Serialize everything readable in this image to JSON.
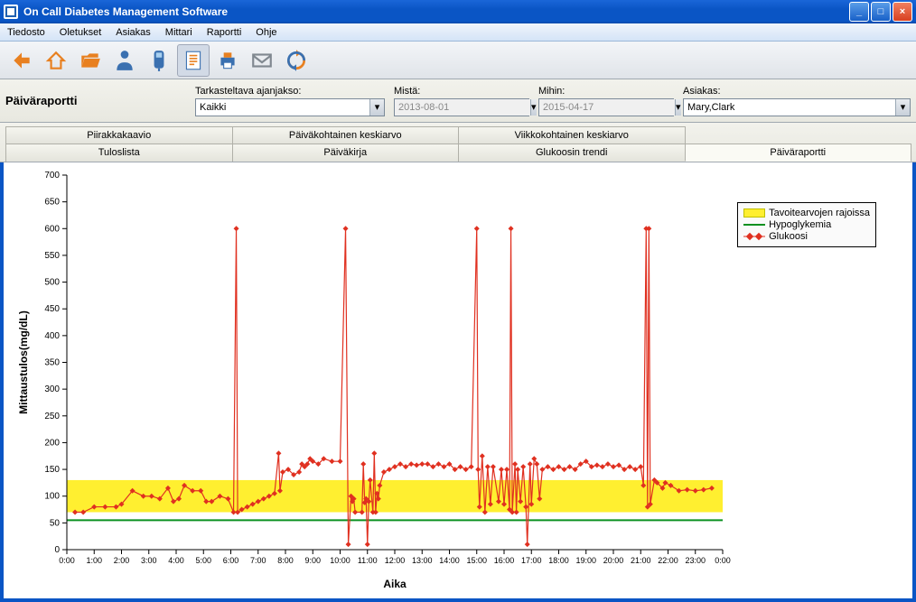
{
  "window": {
    "title": "On Call Diabetes Management Software"
  },
  "menu": {
    "items": [
      "Tiedosto",
      "Oletukset",
      "Asiakas",
      "Mittari",
      "Raportti",
      "Ohje"
    ]
  },
  "toolbar": {
    "icons": [
      "back-icon",
      "home-icon",
      "open-icon",
      "user-icon",
      "meter-icon",
      "report-icon",
      "print-icon",
      "mail-icon",
      "sync-icon"
    ]
  },
  "filters": {
    "title": "Päiväraportti",
    "range_label": "Tarkasteltava ajanjakso:",
    "range_value": "Kaikki",
    "from_label": "Mistä:",
    "from_value": "2013-08-01",
    "to_label": "Mihin:",
    "to_value": "2015-04-17",
    "client_label": "Asiakas:",
    "client_value": "Mary,Clark"
  },
  "tabs": {
    "row1": [
      "Piirakkakaavio",
      "Päiväkohtainen keskiarvo",
      "Viikkokohtainen keskiarvo",
      ""
    ],
    "row2": [
      "Tuloslista",
      "Päiväkirja",
      "Glukoosin trendi",
      "Päiväraportti"
    ],
    "active": "Päiväraportti"
  },
  "legend": {
    "target": "Tavoitearvojen rajoissa",
    "hypo": "Hypoglykemia",
    "glucose": "Glukoosi"
  },
  "chart_data": {
    "type": "line",
    "xlabel": "Aika",
    "ylabel": "Mittaustulos(mg/dL)",
    "ylim": [
      0,
      700
    ],
    "y_ticks": [
      0,
      50,
      100,
      150,
      200,
      250,
      300,
      350,
      400,
      450,
      500,
      550,
      600,
      650,
      700
    ],
    "x_ticks": [
      "0:00",
      "1:00",
      "2:00",
      "3:00",
      "4:00",
      "5:00",
      "6:00",
      "7:00",
      "8:00",
      "9:00",
      "10:00",
      "11:00",
      "12:00",
      "13:00",
      "14:00",
      "15:00",
      "16:00",
      "17:00",
      "18:00",
      "19:00",
      "20:00",
      "21:00",
      "22:00",
      "23:00",
      "0:00"
    ],
    "target_band": {
      "low": 70,
      "high": 130
    },
    "hypo_line": 55,
    "series": [
      {
        "name": "Glukoosi",
        "color": "#e03020",
        "points": [
          [
            0.3,
            70
          ],
          [
            0.6,
            70
          ],
          [
            1.0,
            80
          ],
          [
            1.4,
            80
          ],
          [
            1.8,
            80
          ],
          [
            2.0,
            85
          ],
          [
            2.4,
            110
          ],
          [
            2.8,
            100
          ],
          [
            3.1,
            100
          ],
          [
            3.4,
            95
          ],
          [
            3.7,
            115
          ],
          [
            3.9,
            90
          ],
          [
            4.1,
            95
          ],
          [
            4.3,
            120
          ],
          [
            4.6,
            110
          ],
          [
            4.9,
            110
          ],
          [
            5.1,
            90
          ],
          [
            5.3,
            90
          ],
          [
            5.6,
            100
          ],
          [
            5.9,
            95
          ],
          [
            6.1,
            70
          ],
          [
            6.2,
            600
          ],
          [
            6.25,
            70
          ],
          [
            6.4,
            75
          ],
          [
            6.6,
            80
          ],
          [
            6.8,
            85
          ],
          [
            7.0,
            90
          ],
          [
            7.2,
            95
          ],
          [
            7.4,
            100
          ],
          [
            7.6,
            105
          ],
          [
            7.75,
            180
          ],
          [
            7.8,
            110
          ],
          [
            7.9,
            145
          ],
          [
            8.1,
            150
          ],
          [
            8.3,
            140
          ],
          [
            8.5,
            145
          ],
          [
            8.6,
            160
          ],
          [
            8.7,
            155
          ],
          [
            8.8,
            160
          ],
          [
            8.9,
            170
          ],
          [
            9.0,
            165
          ],
          [
            9.2,
            160
          ],
          [
            9.4,
            170
          ],
          [
            9.7,
            165
          ],
          [
            10.0,
            165
          ],
          [
            10.2,
            600
          ],
          [
            10.3,
            10
          ],
          [
            10.4,
            100
          ],
          [
            10.45,
            90
          ],
          [
            10.5,
            95
          ],
          [
            10.55,
            70
          ],
          [
            10.8,
            70
          ],
          [
            10.85,
            160
          ],
          [
            10.9,
            88
          ],
          [
            10.95,
            95
          ],
          [
            11.0,
            10
          ],
          [
            11.05,
            90
          ],
          [
            11.1,
            130
          ],
          [
            11.2,
            70
          ],
          [
            11.25,
            180
          ],
          [
            11.3,
            70
          ],
          [
            11.35,
            105
          ],
          [
            11.4,
            95
          ],
          [
            11.45,
            120
          ],
          [
            11.6,
            145
          ],
          [
            11.8,
            150
          ],
          [
            12.0,
            155
          ],
          [
            12.2,
            160
          ],
          [
            12.4,
            155
          ],
          [
            12.6,
            160
          ],
          [
            12.8,
            158
          ],
          [
            13.0,
            160
          ],
          [
            13.2,
            160
          ],
          [
            13.4,
            155
          ],
          [
            13.6,
            160
          ],
          [
            13.8,
            155
          ],
          [
            14.0,
            160
          ],
          [
            14.2,
            150
          ],
          [
            14.4,
            155
          ],
          [
            14.6,
            150
          ],
          [
            14.8,
            155
          ],
          [
            15.0,
            600
          ],
          [
            15.05,
            150
          ],
          [
            15.1,
            80
          ],
          [
            15.2,
            175
          ],
          [
            15.3,
            70
          ],
          [
            15.4,
            155
          ],
          [
            15.5,
            85
          ],
          [
            15.6,
            155
          ],
          [
            15.8,
            90
          ],
          [
            15.9,
            150
          ],
          [
            16.0,
            85
          ],
          [
            16.1,
            150
          ],
          [
            16.2,
            75
          ],
          [
            16.25,
            600
          ],
          [
            16.3,
            70
          ],
          [
            16.4,
            160
          ],
          [
            16.45,
            70
          ],
          [
            16.5,
            150
          ],
          [
            16.6,
            90
          ],
          [
            16.7,
            155
          ],
          [
            16.8,
            80
          ],
          [
            16.85,
            10
          ],
          [
            16.95,
            160
          ],
          [
            17.0,
            85
          ],
          [
            17.1,
            170
          ],
          [
            17.2,
            160
          ],
          [
            17.3,
            95
          ],
          [
            17.4,
            150
          ],
          [
            17.6,
            155
          ],
          [
            17.8,
            150
          ],
          [
            18.0,
            155
          ],
          [
            18.2,
            150
          ],
          [
            18.4,
            155
          ],
          [
            18.6,
            150
          ],
          [
            18.8,
            160
          ],
          [
            19.0,
            165
          ],
          [
            19.2,
            155
          ],
          [
            19.4,
            158
          ],
          [
            19.6,
            155
          ],
          [
            19.8,
            160
          ],
          [
            20.0,
            155
          ],
          [
            20.2,
            158
          ],
          [
            20.4,
            150
          ],
          [
            20.6,
            155
          ],
          [
            20.8,
            150
          ],
          [
            21.0,
            155
          ],
          [
            21.1,
            120
          ],
          [
            21.2,
            600
          ],
          [
            21.25,
            80
          ],
          [
            21.3,
            600
          ],
          [
            21.35,
            85
          ],
          [
            21.5,
            130
          ],
          [
            21.6,
            125
          ],
          [
            21.8,
            115
          ],
          [
            21.9,
            125
          ],
          [
            22.1,
            120
          ],
          [
            22.4,
            110
          ],
          [
            22.7,
            112
          ],
          [
            23.0,
            110
          ],
          [
            23.3,
            112
          ],
          [
            23.6,
            115
          ]
        ]
      }
    ]
  }
}
